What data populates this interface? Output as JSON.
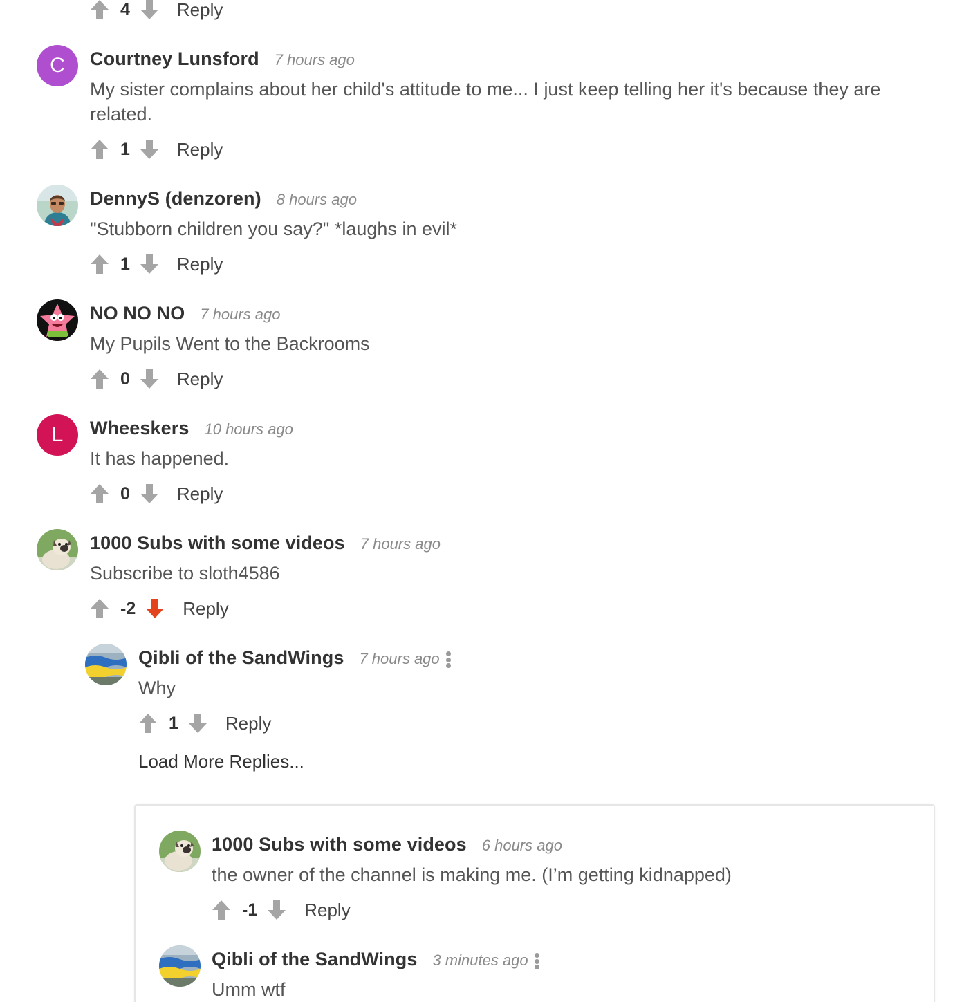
{
  "colors": {
    "vote_gray": "#a5a5a5",
    "downvote_active": "#e3441e",
    "avatar_c": "#b04ed0",
    "avatar_l": "#d21456"
  },
  "top_partial": {
    "count": "4",
    "reply": "Reply"
  },
  "comments": [
    {
      "author": "Courtney Lunsford",
      "time": "7 hours ago",
      "text": "My sister complains about her child's attitude to me... I just keep telling her it's because they are related.",
      "count": "1",
      "reply": "Reply",
      "avatar_letter": "C"
    },
    {
      "author": "DennyS (denzoren)",
      "time": "8 hours ago",
      "text": "\"Stubborn children you say?\" *laughs in evil*",
      "count": "1",
      "reply": "Reply",
      "avatar_icon": "person-photo-icon"
    },
    {
      "author": "NO NO NO",
      "time": "7 hours ago",
      "text": "My Pupils Went to the Backrooms",
      "count": "0",
      "reply": "Reply",
      "avatar_icon": "starfish-icon"
    },
    {
      "author": "Wheeskers",
      "time": "10 hours ago",
      "text": "It has happened.",
      "count": "0",
      "reply": "Reply",
      "avatar_letter": "L"
    },
    {
      "author": "1000 Subs with some videos",
      "time": "7 hours ago",
      "text": "Subscribe to sloth4586",
      "count": "-2",
      "reply": "Reply",
      "avatar_icon": "pug-icon",
      "downvoted": true
    }
  ],
  "nested": {
    "author": "Qibli of the SandWings",
    "time": "7 hours ago",
    "text": "Why",
    "count": "1",
    "reply": "Reply",
    "avatar_icon": "flag-icon",
    "load_more": "Load More Replies..."
  },
  "panel": [
    {
      "author": "1000 Subs with some videos",
      "time": "6 hours ago",
      "text": "the owner of the channel is making me. (I’m getting kidnapped)",
      "count": "-1",
      "reply": "Reply",
      "avatar_icon": "pug-icon"
    },
    {
      "author": "Qibli of the SandWings",
      "time": "3 minutes ago",
      "text": "Umm wtf",
      "avatar_icon": "flag-icon"
    }
  ]
}
